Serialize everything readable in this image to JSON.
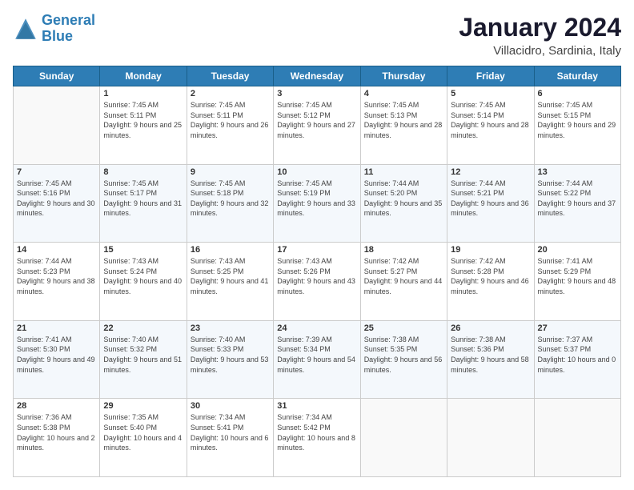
{
  "header": {
    "logo_line1": "General",
    "logo_line2": "Blue",
    "title": "January 2024",
    "subtitle": "Villacidro, Sardinia, Italy"
  },
  "days_of_week": [
    "Sunday",
    "Monday",
    "Tuesday",
    "Wednesday",
    "Thursday",
    "Friday",
    "Saturday"
  ],
  "weeks": [
    [
      {
        "day": "",
        "sunrise": "",
        "sunset": "",
        "daylight": ""
      },
      {
        "day": "1",
        "sunrise": "Sunrise: 7:45 AM",
        "sunset": "Sunset: 5:11 PM",
        "daylight": "Daylight: 9 hours and 25 minutes."
      },
      {
        "day": "2",
        "sunrise": "Sunrise: 7:45 AM",
        "sunset": "Sunset: 5:11 PM",
        "daylight": "Daylight: 9 hours and 26 minutes."
      },
      {
        "day": "3",
        "sunrise": "Sunrise: 7:45 AM",
        "sunset": "Sunset: 5:12 PM",
        "daylight": "Daylight: 9 hours and 27 minutes."
      },
      {
        "day": "4",
        "sunrise": "Sunrise: 7:45 AM",
        "sunset": "Sunset: 5:13 PM",
        "daylight": "Daylight: 9 hours and 28 minutes."
      },
      {
        "day": "5",
        "sunrise": "Sunrise: 7:45 AM",
        "sunset": "Sunset: 5:14 PM",
        "daylight": "Daylight: 9 hours and 28 minutes."
      },
      {
        "day": "6",
        "sunrise": "Sunrise: 7:45 AM",
        "sunset": "Sunset: 5:15 PM",
        "daylight": "Daylight: 9 hours and 29 minutes."
      }
    ],
    [
      {
        "day": "7",
        "sunrise": "Sunrise: 7:45 AM",
        "sunset": "Sunset: 5:16 PM",
        "daylight": "Daylight: 9 hours and 30 minutes."
      },
      {
        "day": "8",
        "sunrise": "Sunrise: 7:45 AM",
        "sunset": "Sunset: 5:17 PM",
        "daylight": "Daylight: 9 hours and 31 minutes."
      },
      {
        "day": "9",
        "sunrise": "Sunrise: 7:45 AM",
        "sunset": "Sunset: 5:18 PM",
        "daylight": "Daylight: 9 hours and 32 minutes."
      },
      {
        "day": "10",
        "sunrise": "Sunrise: 7:45 AM",
        "sunset": "Sunset: 5:19 PM",
        "daylight": "Daylight: 9 hours and 33 minutes."
      },
      {
        "day": "11",
        "sunrise": "Sunrise: 7:44 AM",
        "sunset": "Sunset: 5:20 PM",
        "daylight": "Daylight: 9 hours and 35 minutes."
      },
      {
        "day": "12",
        "sunrise": "Sunrise: 7:44 AM",
        "sunset": "Sunset: 5:21 PM",
        "daylight": "Daylight: 9 hours and 36 minutes."
      },
      {
        "day": "13",
        "sunrise": "Sunrise: 7:44 AM",
        "sunset": "Sunset: 5:22 PM",
        "daylight": "Daylight: 9 hours and 37 minutes."
      }
    ],
    [
      {
        "day": "14",
        "sunrise": "Sunrise: 7:44 AM",
        "sunset": "Sunset: 5:23 PM",
        "daylight": "Daylight: 9 hours and 38 minutes."
      },
      {
        "day": "15",
        "sunrise": "Sunrise: 7:43 AM",
        "sunset": "Sunset: 5:24 PM",
        "daylight": "Daylight: 9 hours and 40 minutes."
      },
      {
        "day": "16",
        "sunrise": "Sunrise: 7:43 AM",
        "sunset": "Sunset: 5:25 PM",
        "daylight": "Daylight: 9 hours and 41 minutes."
      },
      {
        "day": "17",
        "sunrise": "Sunrise: 7:43 AM",
        "sunset": "Sunset: 5:26 PM",
        "daylight": "Daylight: 9 hours and 43 minutes."
      },
      {
        "day": "18",
        "sunrise": "Sunrise: 7:42 AM",
        "sunset": "Sunset: 5:27 PM",
        "daylight": "Daylight: 9 hours and 44 minutes."
      },
      {
        "day": "19",
        "sunrise": "Sunrise: 7:42 AM",
        "sunset": "Sunset: 5:28 PM",
        "daylight": "Daylight: 9 hours and 46 minutes."
      },
      {
        "day": "20",
        "sunrise": "Sunrise: 7:41 AM",
        "sunset": "Sunset: 5:29 PM",
        "daylight": "Daylight: 9 hours and 48 minutes."
      }
    ],
    [
      {
        "day": "21",
        "sunrise": "Sunrise: 7:41 AM",
        "sunset": "Sunset: 5:30 PM",
        "daylight": "Daylight: 9 hours and 49 minutes."
      },
      {
        "day": "22",
        "sunrise": "Sunrise: 7:40 AM",
        "sunset": "Sunset: 5:32 PM",
        "daylight": "Daylight: 9 hours and 51 minutes."
      },
      {
        "day": "23",
        "sunrise": "Sunrise: 7:40 AM",
        "sunset": "Sunset: 5:33 PM",
        "daylight": "Daylight: 9 hours and 53 minutes."
      },
      {
        "day": "24",
        "sunrise": "Sunrise: 7:39 AM",
        "sunset": "Sunset: 5:34 PM",
        "daylight": "Daylight: 9 hours and 54 minutes."
      },
      {
        "day": "25",
        "sunrise": "Sunrise: 7:38 AM",
        "sunset": "Sunset: 5:35 PM",
        "daylight": "Daylight: 9 hours and 56 minutes."
      },
      {
        "day": "26",
        "sunrise": "Sunrise: 7:38 AM",
        "sunset": "Sunset: 5:36 PM",
        "daylight": "Daylight: 9 hours and 58 minutes."
      },
      {
        "day": "27",
        "sunrise": "Sunrise: 7:37 AM",
        "sunset": "Sunset: 5:37 PM",
        "daylight": "Daylight: 10 hours and 0 minutes."
      }
    ],
    [
      {
        "day": "28",
        "sunrise": "Sunrise: 7:36 AM",
        "sunset": "Sunset: 5:38 PM",
        "daylight": "Daylight: 10 hours and 2 minutes."
      },
      {
        "day": "29",
        "sunrise": "Sunrise: 7:35 AM",
        "sunset": "Sunset: 5:40 PM",
        "daylight": "Daylight: 10 hours and 4 minutes."
      },
      {
        "day": "30",
        "sunrise": "Sunrise: 7:34 AM",
        "sunset": "Sunset: 5:41 PM",
        "daylight": "Daylight: 10 hours and 6 minutes."
      },
      {
        "day": "31",
        "sunrise": "Sunrise: 7:34 AM",
        "sunset": "Sunset: 5:42 PM",
        "daylight": "Daylight: 10 hours and 8 minutes."
      },
      {
        "day": "",
        "sunrise": "",
        "sunset": "",
        "daylight": ""
      },
      {
        "day": "",
        "sunrise": "",
        "sunset": "",
        "daylight": ""
      },
      {
        "day": "",
        "sunrise": "",
        "sunset": "",
        "daylight": ""
      }
    ]
  ]
}
